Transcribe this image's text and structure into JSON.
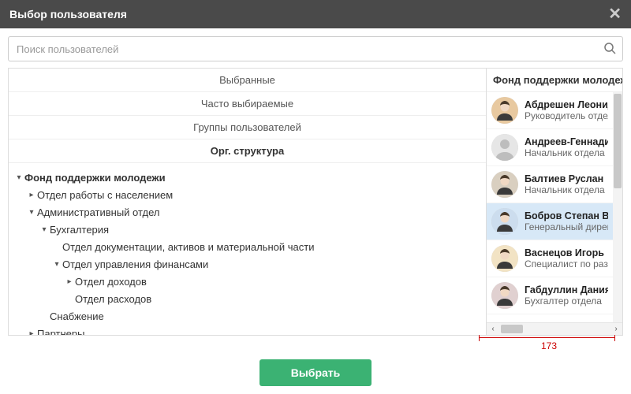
{
  "dialog": {
    "title": "Выбор пользователя",
    "search_placeholder": "Поиск пользователей",
    "select_btn": "Выбрать"
  },
  "sections": {
    "selected": "Выбранные",
    "frequent": "Часто выбираемые",
    "groups": "Группы пользователей",
    "org": "Орг. структура"
  },
  "tree": {
    "root": "Фонд поддержки молодежи",
    "n_pop": "Отдел работы с населением",
    "n_admin": "Административный отдел",
    "n_acc": "Бухгалтерия",
    "n_docs": "Отдел документации, активов и материальной части",
    "n_fin": "Отдел управления финансами",
    "n_income": "Отдел доходов",
    "n_expense": "Отдел расходов",
    "n_supply": "Снабжение",
    "n_partners": "Партнеры"
  },
  "right_header": "Фонд поддержки молодежи",
  "users": [
    {
      "name": "Абдрешен Леонид",
      "role": "Руководитель отдела",
      "avatar_bg": "#e8c9a0",
      "silhouette": false
    },
    {
      "name": "Андреев-Геннадий",
      "role": "Начальник отдела",
      "avatar_bg": "#dcdcdc",
      "silhouette": true
    },
    {
      "name": "Балтиев Руслан",
      "role": "Начальник отдела",
      "avatar_bg": "#d9cfc0",
      "silhouette": false
    },
    {
      "name": "Бобров Степан В",
      "role": "Генеральный директор",
      "avatar_bg": "#cde",
      "silhouette": false,
      "selected": true
    },
    {
      "name": "Васнецов Игорь",
      "role": "Специалист по развитию",
      "avatar_bg": "#f2e3c4",
      "silhouette": false
    },
    {
      "name": "Габдуллин Данияр",
      "role": "Бухгалтер отдела",
      "avatar_bg": "#e0d0d0",
      "silhouette": false
    }
  ],
  "measure": {
    "value": "173"
  },
  "glyphs": {
    "tri_open": "▾",
    "tri_closed": "▸",
    "scroll_left": "‹",
    "scroll_right": "›"
  }
}
